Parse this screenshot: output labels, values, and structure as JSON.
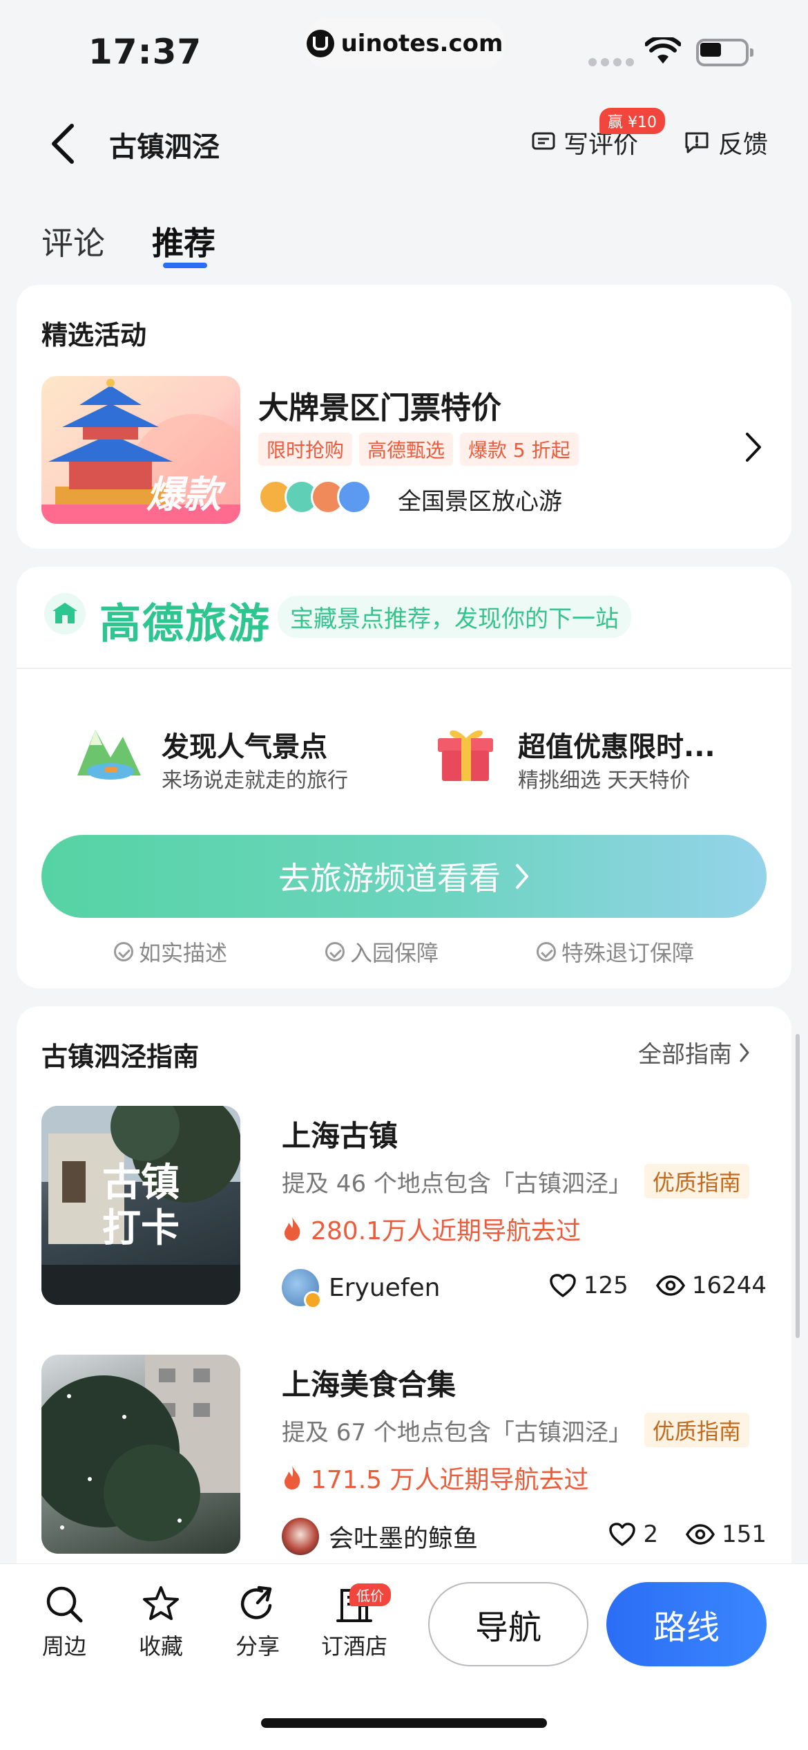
{
  "status_bar": {
    "time": "17:37",
    "url": "uinotes.com"
  },
  "header": {
    "title": "古镇泗泾",
    "write_review": "写评价",
    "reward_badge": "赢 ¥10",
    "feedback": "反馈"
  },
  "tabs": [
    {
      "label": "评论",
      "active": false
    },
    {
      "label": "推荐",
      "active": true
    }
  ],
  "activities": {
    "section_title": "精选活动",
    "thumb_label": "爆款",
    "title": "大牌景区门票特价",
    "tags": [
      "限时抢购",
      "高德甄选",
      "爆款 5 折起"
    ],
    "caption": "全国景区放心游"
  },
  "travel": {
    "brand": "高德旅游",
    "slogan": "宝藏景点推荐，发现你的下一站",
    "features": [
      {
        "title": "发现人气景点",
        "subtitle": "来场说走就走的旅行",
        "icon": "mountain-icon"
      },
      {
        "title": "超值优惠限时...",
        "subtitle": "精挑细选 天天特价",
        "icon": "gift-icon"
      }
    ],
    "cta": "去旅游频道看看",
    "assurances": [
      "如实描述",
      "入园保障",
      "特殊退订保障"
    ]
  },
  "guides": {
    "section_title": "古镇泗泾指南",
    "all_label": "全部指南",
    "items": [
      {
        "title": "上海古镇",
        "thumb_text": "古镇\n打卡",
        "desc": "提及 46 个地点包含「古镇泗泾」",
        "badge": "优质指南",
        "heat": "280.1万人近期导航去过",
        "author": "Eryuefen",
        "likes": "125",
        "views": "16244"
      },
      {
        "title": "上海美食合集",
        "thumb_text": "",
        "desc": "提及 67 个地点包含「古镇泗泾」",
        "badge": "优质指南",
        "heat": "171.5 万人近期导航去过",
        "author": "会吐墨的鲸鱼",
        "likes": "2",
        "views": "151"
      }
    ]
  },
  "bottom_bar": {
    "items": [
      {
        "label": "周边",
        "icon": "search-icon"
      },
      {
        "label": "收藏",
        "icon": "star-icon"
      },
      {
        "label": "分享",
        "icon": "share-icon"
      },
      {
        "label": "订酒店",
        "icon": "hotel-icon"
      }
    ],
    "hotel_badge": "低价",
    "nav_label": "导航",
    "route_label": "路线"
  },
  "colors": {
    "accent_blue": "#2b6ef5",
    "travel_green": "#2ec690",
    "heat_orange": "#ec5b3a",
    "badge_red": "#f2463d"
  }
}
